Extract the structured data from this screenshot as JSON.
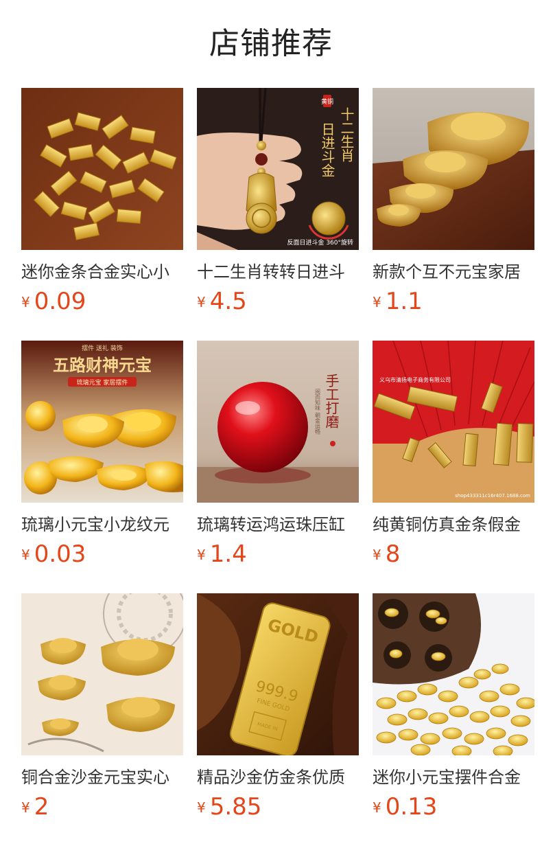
{
  "header": {
    "title": "店铺推荐"
  },
  "accent_color": "#e4461a",
  "products": [
    {
      "name": "迷你金条合金实心小",
      "currency": "¥",
      "price": "0.09",
      "image": "mini-gold-bars-pile"
    },
    {
      "name": "十二生肖转转日进斗",
      "currency": "¥",
      "price": "4.5",
      "image": "zodiac-pendant",
      "image_texts": {
        "badge": "黄铜",
        "vertical1": "十二生肖",
        "vertical2": "日进斗金",
        "caption": "反面日进斗金 360°旋转"
      }
    },
    {
      "name": "新款个互不元宝家居",
      "currency": "¥",
      "price": "1.1",
      "image": "gold-ingots-stack"
    },
    {
      "name": "琉璃小元宝小龙纹元",
      "currency": "¥",
      "price": "0.03",
      "image": "glass-yuanbao",
      "image_texts": {
        "top": "摆件 送礼 装饰",
        "headline": "五路财神元宝",
        "sub": "琉璃元宝 家居摆件"
      }
    },
    {
      "name": "琉璃转运鸿运珠压缸",
      "currency": "¥",
      "price": "1.4",
      "image": "red-glass-ball",
      "image_texts": {
        "vertical": "手工打磨",
        "small": "阅而知味 朝金运畅"
      }
    },
    {
      "name": "纯黄铜仿真金条假金",
      "currency": "¥",
      "price": "8",
      "image": "brass-bars-red-fan",
      "image_texts": {
        "watermark": "义乌市清扬电子商务有限公司",
        "shop": "shop433311c16r407.1688.com"
      }
    },
    {
      "name": "铜合金沙金元宝实心",
      "currency": "¥",
      "price": "2",
      "image": "sand-gold-ingots"
    },
    {
      "name": "精品沙金仿金条优质",
      "currency": "¥",
      "price": "5.85",
      "image": "gold-bar-999",
      "image_texts": {
        "brand": "GOLD",
        "purity": "999.9",
        "fine": "FINE GOLD",
        "made": "MADE IN"
      }
    },
    {
      "name": "迷你小元宝摆件合金",
      "currency": "¥",
      "price": "0.13",
      "image": "mini-yuanbao-pile"
    }
  ]
}
